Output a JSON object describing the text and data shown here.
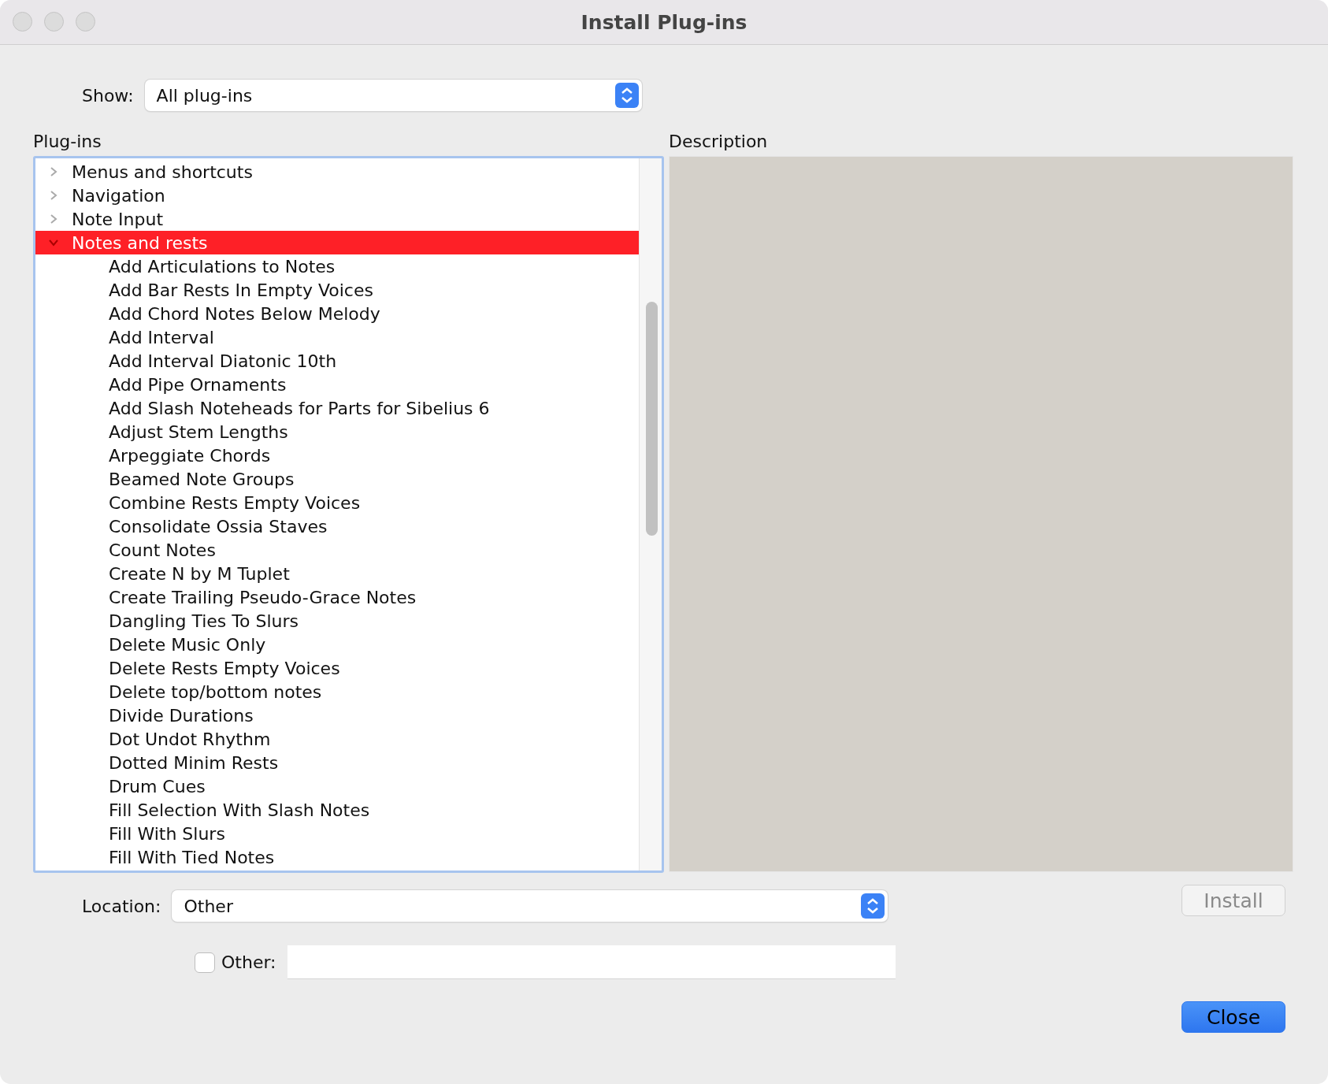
{
  "window": {
    "title": "Install Plug-ins"
  },
  "show": {
    "label": "Show:",
    "value": "All plug-ins"
  },
  "plugins_label": "Plug-ins",
  "description_label": "Description",
  "tree": [
    {
      "label": "Menus and shortcuts",
      "expanded": false,
      "selected": false
    },
    {
      "label": "Navigation",
      "expanded": false,
      "selected": false
    },
    {
      "label": "Note Input",
      "expanded": false,
      "selected": false
    },
    {
      "label": "Notes and rests",
      "expanded": true,
      "selected": true,
      "children": [
        {
          "label": "Add Articulations to Notes",
          "selected": false
        },
        {
          "label": "Add Bar Rests In Empty Voices",
          "selected": false
        },
        {
          "label": "Add Chord Notes Below Melody",
          "selected": false
        },
        {
          "label": "Add Interval",
          "selected": false
        },
        {
          "label": "Add Interval Diatonic 10th",
          "selected": false
        },
        {
          "label": "Add Pipe Ornaments",
          "selected": false
        },
        {
          "label": "Add Slash Noteheads for Parts for Sibelius 6",
          "selected": false
        },
        {
          "label": "Adjust Stem Lengths",
          "selected": false
        },
        {
          "label": "Arpeggiate Chords",
          "selected": false
        },
        {
          "label": "Beamed Note Groups",
          "selected": false
        },
        {
          "label": "Combine Rests Empty Voices",
          "selected": false
        },
        {
          "label": "Consolidate Ossia Staves",
          "selected": false
        },
        {
          "label": "Count Notes",
          "selected": false
        },
        {
          "label": "Create N by M Tuplet",
          "selected": false
        },
        {
          "label": "Create Trailing Pseudo-Grace Notes",
          "selected": false
        },
        {
          "label": "Dangling Ties To Slurs",
          "selected": false
        },
        {
          "label": "Delete Music Only",
          "selected": false
        },
        {
          "label": "Delete Rests Empty Voices",
          "selected": false
        },
        {
          "label": "Delete top/bottom notes",
          "selected": false
        },
        {
          "label": "Divide Durations",
          "selected": false
        },
        {
          "label": "Dot Undot Rhythm",
          "selected": false
        },
        {
          "label": "Dotted Minim Rests",
          "selected": false
        },
        {
          "label": "Drum Cues",
          "selected": false
        },
        {
          "label": "Fill Selection With Slash Notes",
          "selected": false
        },
        {
          "label": "Fill With Slurs",
          "selected": false
        },
        {
          "label": "Fill With Tied Notes",
          "selected": false
        }
      ]
    }
  ],
  "location": {
    "label": "Location:",
    "value": "Other"
  },
  "install_button": {
    "label": "Install",
    "disabled": true
  },
  "other": {
    "label": "Other:",
    "checked": false
  },
  "close_button": {
    "label": "Close"
  }
}
